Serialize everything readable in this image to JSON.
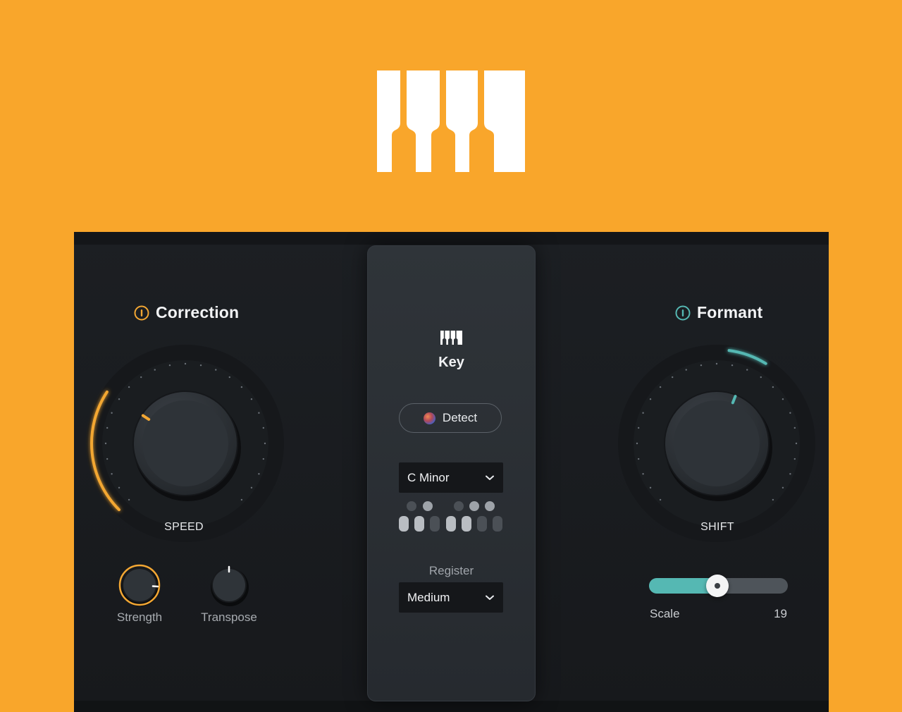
{
  "correction": {
    "title": "Correction",
    "speed_label": "SPEED",
    "speed_value": 0.29,
    "strength_label": "Strength",
    "strength_value": 0.85,
    "transpose_label": "Transpose",
    "transpose_value": 0.5
  },
  "key": {
    "title": "Key",
    "detect_label": "Detect",
    "key_value": "C Minor",
    "register_label": "Register",
    "register_value": "Medium",
    "scale_black_keys_active": [
      false,
      true,
      false,
      true,
      true
    ],
    "scale_white_keys_active": [
      true,
      true,
      false,
      true,
      true,
      false,
      false
    ]
  },
  "formant": {
    "title": "Formant",
    "shift_label": "SHIFT",
    "shift_value": 0.58,
    "scale_label": "Scale",
    "scale_value": "19",
    "scale_fraction": 0.49
  },
  "colors": {
    "background": "#F9A62B",
    "correction_accent": "#F3A733",
    "formant_accent": "#55B8B3",
    "panel": "#1B1E21"
  }
}
